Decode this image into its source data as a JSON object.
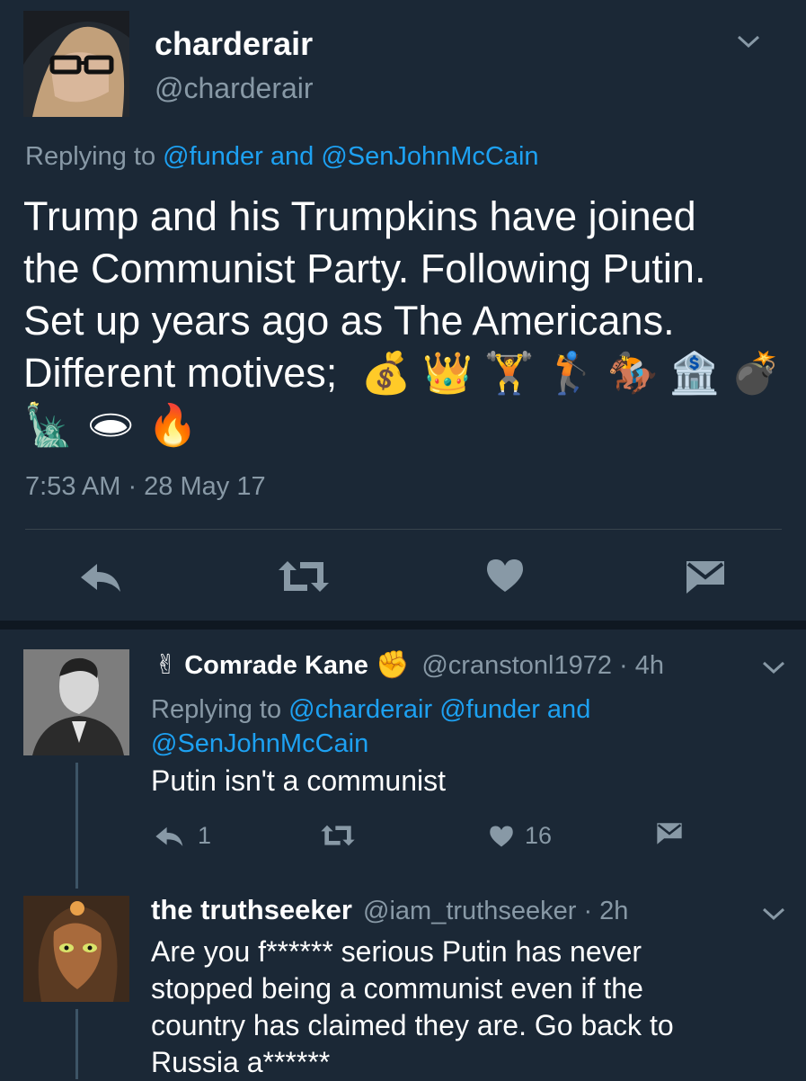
{
  "main_tweet": {
    "display_name": "charderair",
    "handle": "@charderair",
    "replying_prefix": "Replying to ",
    "replying_to": "@funder and @SenJohnMcCain",
    "text": "Trump and his Trumpkins have joined the Communist Party. Following Putin. Set up years ago as The Americans. Different motives; 💰👑🏋️🏌️🏇🏦💣🗽🕳️🔥",
    "text_lines": [
      "Trump and his Trumpkins have joined",
      "the Communist Party. Following Putin.",
      "Set up years ago as The Americans.",
      "Different motives;"
    ],
    "emoji_line1": [
      "💰",
      "👑",
      "🏋",
      "🏌",
      "🏇",
      "🏦",
      "💣"
    ],
    "emoji_line2": [
      "🗽",
      "🕳",
      "🔥"
    ],
    "timestamp": "7:53 AM · 28 May 17"
  },
  "replies": [
    {
      "display_name_prefix": "✌",
      "display_name": "Comrade Kane",
      "display_name_suffix": "✊",
      "handle_time": "@cranstonl1972 · 4h",
      "replying_prefix": "Replying to ",
      "replying_line1": "@charderair @funder and",
      "replying_line2": "@SenJohnMcCain",
      "text": "Putin isn't a communist",
      "reply_count": "1",
      "like_count": "16"
    },
    {
      "display_name": "the truthseeker",
      "handle_time": "@iam_truthseeker · 2h",
      "text_lines": [
        "Are you f****** serious Putin has never",
        "stopped being a communist even if the",
        "country has claimed they are. Go back to",
        "Russia a******"
      ]
    }
  ],
  "icons": {
    "reply": "reply-icon",
    "retweet": "retweet-icon",
    "like": "heart-icon",
    "dm": "envelope-icon",
    "chevron": "chevron-down-icon"
  },
  "colors": {
    "background": "#1b2836",
    "link": "#1da1f2",
    "muted": "#8899a6",
    "text": "#ffffff"
  }
}
